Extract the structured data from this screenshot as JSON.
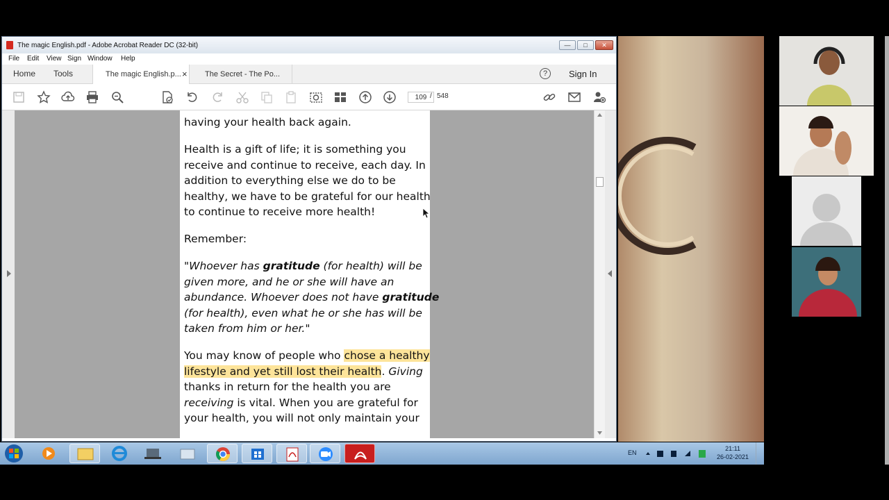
{
  "window": {
    "title": "The magic English.pdf - Adobe Acrobat Reader DC (32-bit)",
    "controls": {
      "minimize": "—",
      "maximize": "□",
      "close": "✕"
    }
  },
  "menu": [
    "File",
    "Edit",
    "View",
    "Sign",
    "Window",
    "Help"
  ],
  "tabs": {
    "home": "Home",
    "tools": "Tools",
    "doc1": "The magic English.p...",
    "doc1_close": "×",
    "doc2": "The Secret - The Po...",
    "help": "?",
    "sign_in": "Sign In"
  },
  "toolbar": {
    "page_current": "109",
    "page_sep": "/",
    "page_total": "548",
    "icons": [
      "save-icon",
      "star-icon",
      "upload-icon",
      "print-icon",
      "search-icon",
      "pdf-page-icon",
      "undo-icon",
      "redo-icon",
      "cut-icon",
      "copy-icon",
      "paste-icon",
      "screenshot-icon",
      "stamp-icon",
      "page-up-icon",
      "page-down-icon",
      "link-icon",
      "mail-icon",
      "add-user-icon"
    ]
  },
  "document": {
    "lines": [
      "having your health back again.",
      "Health is a gift of life; it is something you",
      "receive and continue to receive, each day. In",
      "addition to everything else we do to be",
      "healthy, we have to be grateful for our health",
      "to continue to receive more health!",
      "Remember:",
      "You may know of people who",
      "chose a healthy",
      "lifestyle and yet still lost their health",
      ". ",
      "Giving",
      "thanks in return for the health you are",
      "receiving",
      " is vital. When you are grateful for",
      "your health, you will not only maintain your"
    ],
    "quote": {
      "q1a": "\"Whoever has ",
      "q1b": "gratitude",
      "q1c": " (for health) will be",
      "q2": "given more, and he or she will have an",
      "q3a": "abundance. Whoever does not have ",
      "q3b": "gratitude",
      "q4": "(for health), even what he or she has will be",
      "q5": "taken from him or her.\""
    }
  },
  "taskbar": {
    "lang": "EN",
    "time": "21:11",
    "date": "26-02-2021",
    "apps": [
      "start-icon",
      "media-player-icon",
      "explorer-icon",
      "ie-icon",
      "app-icon",
      "folder-icon",
      "chrome-icon",
      "store-icon",
      "pdf-icon",
      "zoom-icon",
      "acrobat-icon"
    ]
  },
  "colors": {
    "highlight": "#fde49a",
    "acrobat_red": "#c81e1e"
  }
}
